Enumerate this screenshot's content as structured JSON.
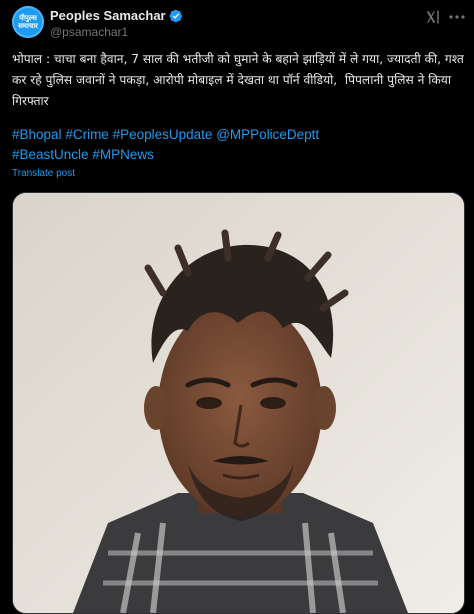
{
  "author": {
    "name": "Peoples Samachar",
    "handle": "@psamachar1",
    "avatar_text_line1": "पीपुल्स",
    "avatar_text_line2": "समाचार"
  },
  "post": {
    "text": "भोपाल : चाचा बना हैवान, 7 साल की भतीजी को घुमाने के बहाने झाड़ियों में ले गया, ज्यादती की, गश्त कर रहे पुलिस जवानों ने पकड़ा, आरोपी मोबाइल में देखता था पॉर्न वीडियो,  पिपलानी पुलिस ने किया गिरफ्तार",
    "hashtags": [
      "#Bhopal",
      "#Crime",
      "#PeoplesUpdate",
      "@MPPoliceDeptt",
      "#BeastUncle",
      "#MPNews"
    ],
    "translate_label": "Translate post"
  },
  "colors": {
    "background": "#000000",
    "accent": "#1d9bf0",
    "text": "#e7e9ea",
    "secondary": "#71767b"
  },
  "icons": [
    "verified-badge-icon",
    "grok-icon",
    "more-options-icon"
  ]
}
